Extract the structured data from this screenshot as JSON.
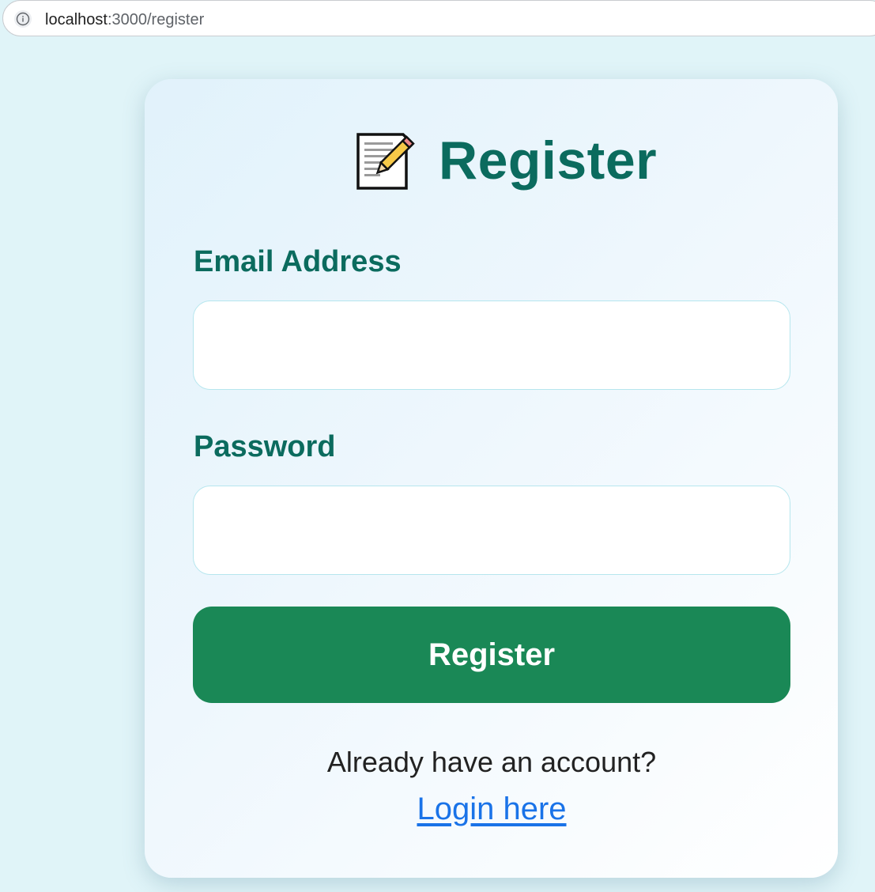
{
  "browser": {
    "url_host": "localhost",
    "url_path": ":3000/register"
  },
  "page": {
    "title": "Register",
    "title_icon": "memo-icon"
  },
  "form": {
    "email_label": "Email Address",
    "email_value": "",
    "password_label": "Password",
    "password_value": "",
    "submit_label": "Register"
  },
  "footer": {
    "prompt": "Already have an account?",
    "login_link": "Login here"
  },
  "colors": {
    "background": "#e0f4f8",
    "heading": "#0b6b5e",
    "button": "#1a8856",
    "link": "#1a73e8"
  }
}
